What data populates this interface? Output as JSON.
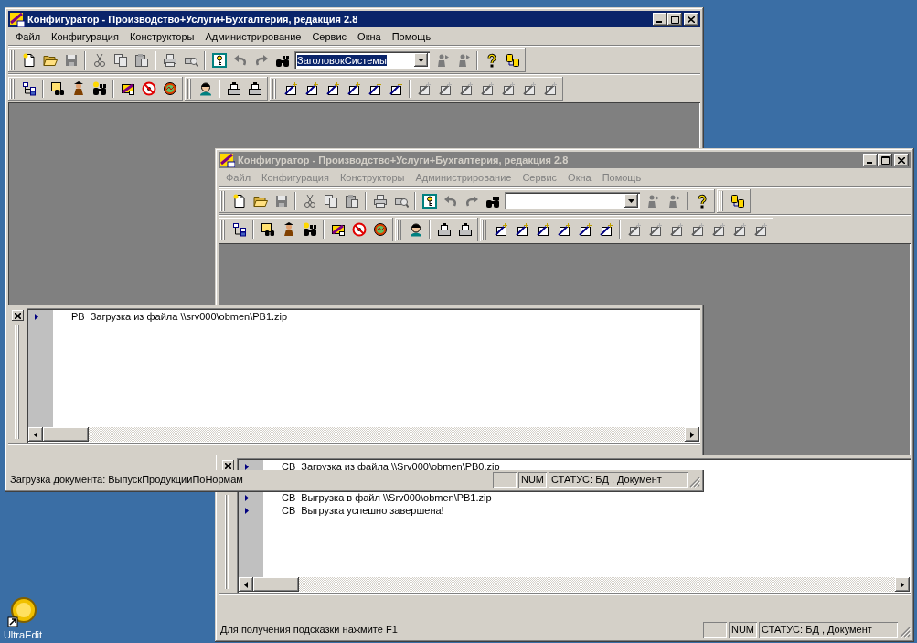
{
  "desktop": {
    "icons": [
      {
        "label": "UltraEdit"
      }
    ]
  },
  "windows": [
    {
      "title": "Конфигуратор - Производство+Услуги+Бухгалтерия, редакция 2.8",
      "active": true,
      "menu": [
        "Файл",
        "Конфигурация",
        "Конструкторы",
        "Администрирование",
        "Сервис",
        "Окна",
        "Помощь"
      ],
      "toolbar_rows": [
        [
          [
            [
              {
                "kind": "new",
                "disabled": false
              },
              {
                "kind": "open",
                "disabled": false
              },
              {
                "kind": "save",
                "disabled": true
              }
            ],
            [
              {
                "kind": "cut",
                "disabled": true
              },
              {
                "kind": "copy",
                "disabled": true
              },
              {
                "kind": "paste",
                "disabled": true
              }
            ],
            [
              {
                "kind": "print",
                "disabled": true
              },
              {
                "kind": "preview",
                "disabled": true
              }
            ],
            [
              {
                "kind": "key",
                "disabled": false
              },
              {
                "kind": "undo",
                "disabled": true
              },
              {
                "kind": "redo",
                "disabled": true
              },
              {
                "kind": "find",
                "disabled": false
              },
              {
                "kind": "combo",
                "value": "ЗаголовокСистемы",
                "highlighted": true,
                "disabled": false
              },
              {
                "kind": "agent",
                "disabled": true
              },
              {
                "kind": "agent",
                "disabled": true
              }
            ],
            [
              {
                "kind": "help",
                "disabled": false
              },
              {
                "kind": "cylinders",
                "disabled": false
              }
            ]
          ]
        ],
        [
          [
            [
              {
                "kind": "tree",
                "disabled": false
              }
            ],
            [
              {
                "kind": "formfind",
                "disabled": false
              },
              {
                "kind": "figure",
                "disabled": false
              },
              {
                "kind": "hintfind",
                "disabled": false
              }
            ],
            [
              {
                "kind": "palette",
                "disabled": false
              },
              {
                "kind": "nosign",
                "disabled": false
              },
              {
                "kind": "gauge",
                "disabled": false
              }
            ]
          ],
          [
            [
              {
                "kind": "head",
                "disabled": false
              }
            ],
            [
              {
                "kind": "stamp",
                "disabled": false
              },
              {
                "kind": "stamp",
                "disabled": false
              }
            ]
          ],
          [
            [
              {
                "kind": "wand",
                "disabled": false
              },
              {
                "kind": "wand",
                "disabled": false
              },
              {
                "kind": "wand",
                "disabled": false
              },
              {
                "kind": "wand",
                "disabled": false
              },
              {
                "kind": "wand",
                "disabled": false
              },
              {
                "kind": "wand",
                "disabled": false
              }
            ],
            [
              {
                "kind": "wand",
                "disabled": true
              },
              {
                "kind": "wand",
                "disabled": true
              },
              {
                "kind": "wand",
                "disabled": true
              },
              {
                "kind": "wand",
                "disabled": true
              },
              {
                "kind": "wand",
                "disabled": true
              },
              {
                "kind": "wand",
                "disabled": true
              },
              {
                "kind": "wand",
                "disabled": true
              }
            ]
          ]
        ]
      ],
      "messages": [
        {
          "source": "РВ",
          "text": "Загрузка из файла \\\\srv000\\obmen\\PB1.zip"
        }
      ],
      "status": {
        "text": "Загрузка документа: ВыпускПродукцииПоНормам",
        "indicator": "NUM",
        "state": "СТАТУС: БД , Документ"
      }
    },
    {
      "title": "Конфигуратор - Производство+Услуги+Бухгалтерия, редакция 2.8",
      "active": false,
      "menu": [
        "Файл",
        "Конфигурация",
        "Конструкторы",
        "Администрирование",
        "Сервис",
        "Окна",
        "Помощь"
      ],
      "toolbar_rows": [
        [
          [
            [
              {
                "kind": "new",
                "disabled": false
              },
              {
                "kind": "open",
                "disabled": false
              },
              {
                "kind": "save",
                "disabled": true
              }
            ],
            [
              {
                "kind": "cut",
                "disabled": true
              },
              {
                "kind": "copy",
                "disabled": true
              },
              {
                "kind": "paste",
                "disabled": true
              }
            ],
            [
              {
                "kind": "print",
                "disabled": true
              },
              {
                "kind": "preview",
                "disabled": true
              }
            ],
            [
              {
                "kind": "key",
                "disabled": false
              },
              {
                "kind": "undo",
                "disabled": true
              },
              {
                "kind": "redo",
                "disabled": true
              },
              {
                "kind": "find",
                "disabled": false
              },
              {
                "kind": "combo",
                "disabled": false
              },
              {
                "kind": "agent",
                "disabled": true
              },
              {
                "kind": "agent",
                "disabled": true
              }
            ],
            [
              {
                "kind": "help",
                "disabled": false
              }
            ]
          ],
          [
            [
              {
                "kind": "cylinders",
                "disabled": false
              }
            ]
          ]
        ],
        [
          [
            [
              {
                "kind": "tree",
                "disabled": false
              }
            ],
            [
              {
                "kind": "formfind",
                "disabled": false
              },
              {
                "kind": "figure",
                "disabled": false
              },
              {
                "kind": "hintfind",
                "disabled": false
              }
            ],
            [
              {
                "kind": "palette",
                "disabled": false
              },
              {
                "kind": "nosign",
                "disabled": false
              },
              {
                "kind": "gauge",
                "disabled": false
              }
            ]
          ],
          [
            [
              {
                "kind": "head",
                "disabled": false
              }
            ],
            [
              {
                "kind": "stamp",
                "disabled": false
              },
              {
                "kind": "stamp",
                "disabled": false
              }
            ]
          ],
          [
            [
              {
                "kind": "wand",
                "disabled": false
              },
              {
                "kind": "wand",
                "disabled": false
              },
              {
                "kind": "wand",
                "disabled": false
              },
              {
                "kind": "wand",
                "disabled": false
              },
              {
                "kind": "wand",
                "disabled": false
              },
              {
                "kind": "wand",
                "disabled": false
              }
            ],
            [
              {
                "kind": "wand",
                "disabled": true
              },
              {
                "kind": "wand",
                "disabled": true
              },
              {
                "kind": "wand",
                "disabled": true
              },
              {
                "kind": "wand",
                "disabled": true
              },
              {
                "kind": "wand",
                "disabled": true
              },
              {
                "kind": "wand",
                "disabled": true
              },
              {
                "kind": "wand",
                "disabled": true
              }
            ]
          ]
        ]
      ],
      "messages": [
        {
          "source": "СВ",
          "text": "Загрузка из файла \\\\Srv000\\obmen\\PB0.zip"
        },
        {
          "source": "СВ",
          "text": "Выгрузка в файл \\\\Srv000\\obmen\\PB1.zip"
        },
        {
          "source": "СВ",
          "text": "Выгрузка успешно завершена!"
        }
      ],
      "status": {
        "text": "Для получения подсказки нажмите F1",
        "indicator": "NUM",
        "state": "СТАТУС: БД , Документ"
      }
    }
  ]
}
